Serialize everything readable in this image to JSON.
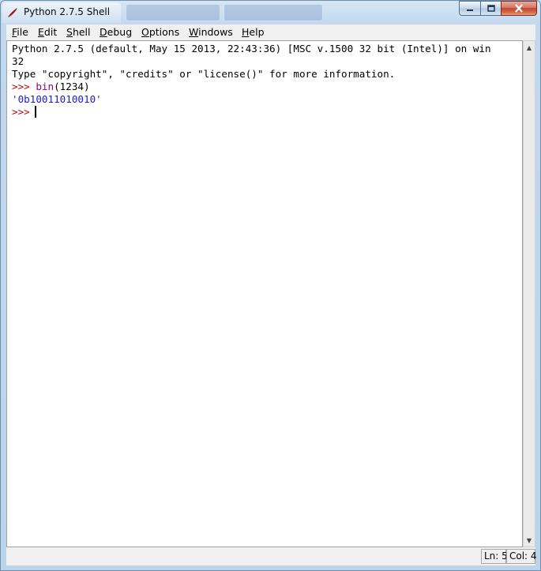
{
  "window": {
    "title": "Python 2.7.5 Shell",
    "icon": "tk-feather-icon",
    "controls": [
      "minimize",
      "maximize",
      "close"
    ]
  },
  "menu": {
    "items": [
      {
        "label": "File",
        "mnemonic": "F",
        "rest": "ile"
      },
      {
        "label": "Edit",
        "mnemonic": "E",
        "rest": "dit"
      },
      {
        "label": "Shell",
        "mnemonic": "S",
        "rest": "hell"
      },
      {
        "label": "Debug",
        "mnemonic": "D",
        "rest": "ebug"
      },
      {
        "label": "Options",
        "mnemonic": "O",
        "rest": "ptions"
      },
      {
        "label": "Windows",
        "mnemonic": "W",
        "rest": "indows"
      },
      {
        "label": "Help",
        "mnemonic": "H",
        "rest": "elp"
      }
    ]
  },
  "shell": {
    "banner_line1": "Python 2.7.5 (default, May 15 2013, 22:43:36) [MSC v.1500 32 bit (Intel)] on win",
    "banner_line2": "32",
    "banner_line3": "Type \"copyright\", \"credits\" or \"license()\" for more information.",
    "prompt": ">>>",
    "command_func": "bin",
    "command_args": "(1234)",
    "result": "'0b10011010010'"
  },
  "status": {
    "line": "Ln: 5",
    "column": "Col: 4"
  },
  "colors": {
    "prompt": "#c00000",
    "builtin": "#900090",
    "output": "#1a1ad0"
  }
}
